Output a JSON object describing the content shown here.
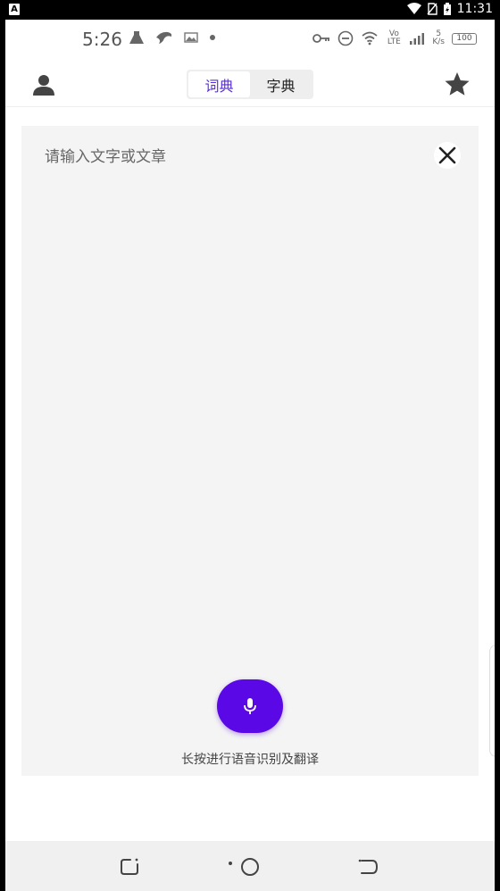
{
  "outer_status": {
    "badge": "A",
    "time": "11:31"
  },
  "inner_status": {
    "time": "5:26",
    "network_type": "Vo LTE",
    "speed_value": "5",
    "speed_unit": "K/s",
    "battery": "100"
  },
  "header": {
    "tabs": [
      {
        "label": "词典",
        "active": true
      },
      {
        "label": "字典",
        "active": false
      }
    ]
  },
  "input": {
    "placeholder": "请输入文字或文章"
  },
  "voice": {
    "hint": "长按进行语音识别及翻译"
  },
  "colors": {
    "accent": "#5b08e6",
    "active_tab_text": "#5a2fd1",
    "card_bg": "#f4f4f4"
  },
  "icons": {
    "user": "person-icon",
    "favorite": "star-icon",
    "clear": "close-icon",
    "mic": "microphone-icon"
  }
}
